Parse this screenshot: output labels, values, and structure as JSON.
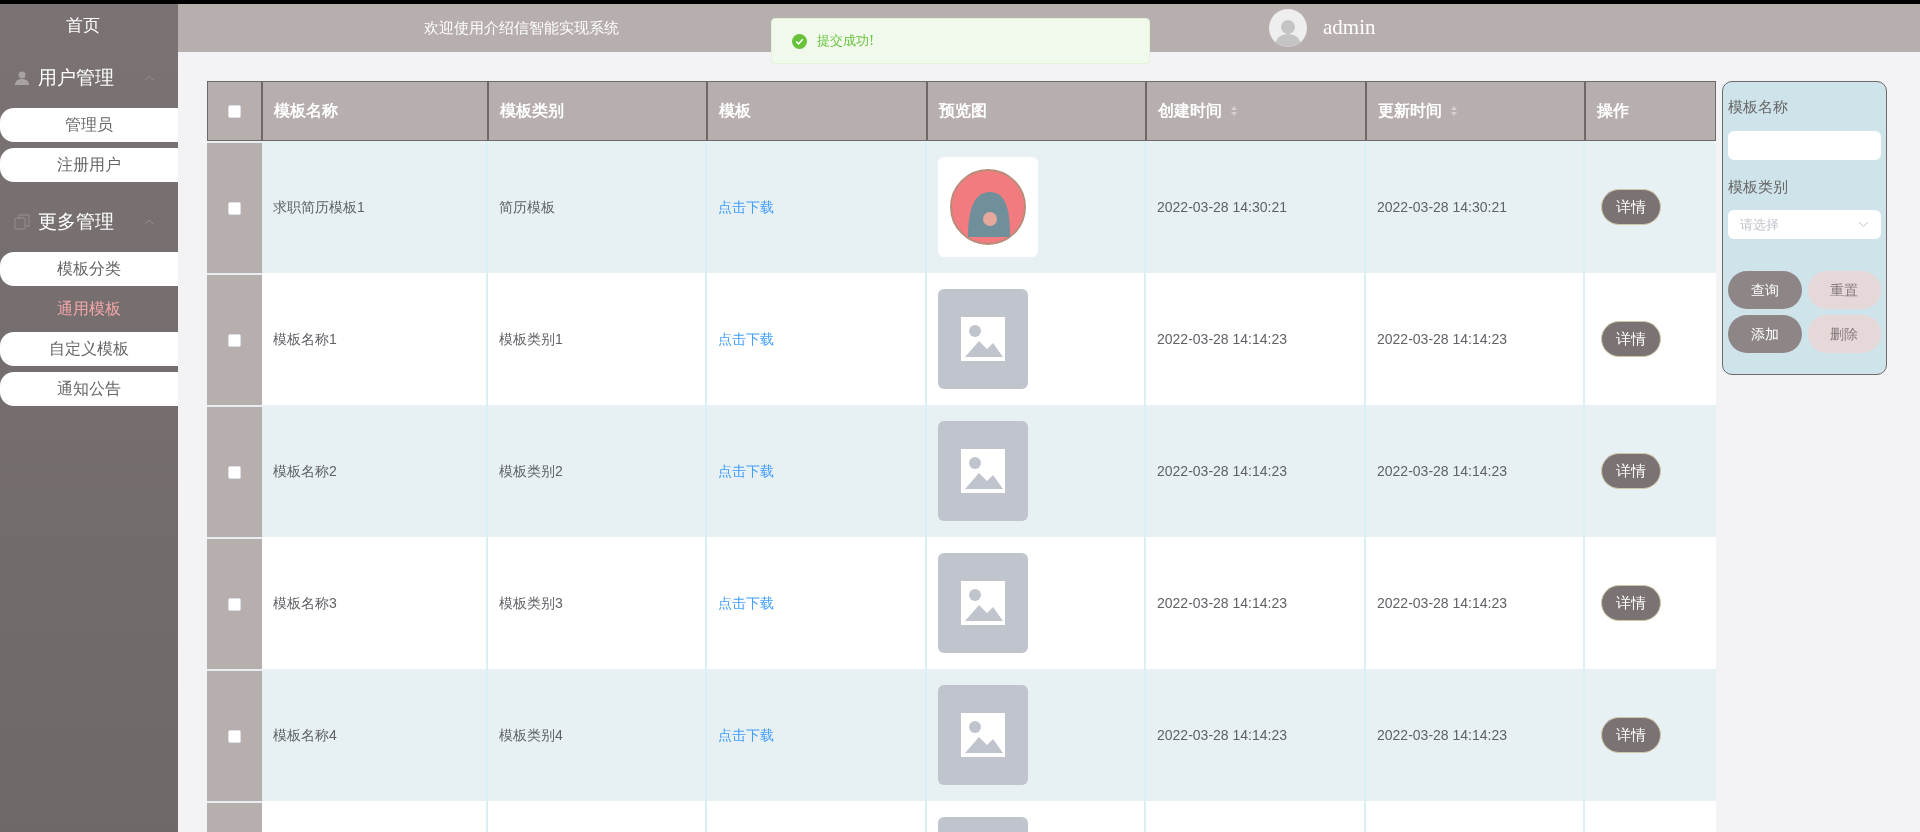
{
  "header": {
    "title": "欢迎使用介绍信智能实现系统",
    "user": "admin"
  },
  "toast": {
    "message": "提交成功!"
  },
  "sidebar": {
    "home": "首页",
    "groups": [
      {
        "title": "用户管理",
        "kind": "user",
        "expanded": true,
        "items": [
          {
            "label": "管理员",
            "selected": false
          },
          {
            "label": "注册用户",
            "selected": false
          }
        ]
      },
      {
        "title": "更多管理",
        "kind": "copy",
        "expanded": true,
        "items": [
          {
            "label": "模板分类",
            "selected": false
          },
          {
            "label": "通用模板",
            "selected": true
          },
          {
            "label": "自定义模板",
            "selected": false
          },
          {
            "label": "通知公告",
            "selected": false
          }
        ]
      }
    ]
  },
  "table": {
    "header_checked": false,
    "columns": [
      {
        "label": "模板名称",
        "sortable": false
      },
      {
        "label": "模板类别",
        "sortable": false
      },
      {
        "label": "模板",
        "sortable": false
      },
      {
        "label": "预览图",
        "sortable": false
      },
      {
        "label": "创建时间",
        "sortable": true
      },
      {
        "label": "更新时间",
        "sortable": true
      },
      {
        "label": "操作",
        "sortable": false
      }
    ],
    "rows": [
      {
        "checked": false,
        "name": "求职简历模板1",
        "category": "简历模板",
        "link": "点击下载",
        "kind": "photo",
        "created": "2022-03-28 14:30:21",
        "updated": "2022-03-28 14:30:21",
        "action": "详情"
      },
      {
        "checked": false,
        "name": "模板名称1",
        "category": "模板类别1",
        "link": "点击下载",
        "kind": "placeholder",
        "created": "2022-03-28 14:14:23",
        "updated": "2022-03-28 14:14:23",
        "action": "详情"
      },
      {
        "checked": false,
        "name": "模板名称2",
        "category": "模板类别2",
        "link": "点击下载",
        "kind": "placeholder",
        "created": "2022-03-28 14:14:23",
        "updated": "2022-03-28 14:14:23",
        "action": "详情"
      },
      {
        "checked": false,
        "name": "模板名称3",
        "category": "模板类别3",
        "link": "点击下载",
        "kind": "placeholder",
        "created": "2022-03-28 14:14:23",
        "updated": "2022-03-28 14:14:23",
        "action": "详情"
      },
      {
        "checked": false,
        "name": "模板名称4",
        "category": "模板类别4",
        "link": "点击下载",
        "kind": "placeholder",
        "created": "2022-03-28 14:14:23",
        "updated": "2022-03-28 14:14:23",
        "action": "详情"
      },
      {
        "kind": "placeholder"
      }
    ]
  },
  "search": {
    "name_label": "模板名称",
    "category_label": "模板类别",
    "category_placeholder": "请选择",
    "buttons": [
      {
        "label": "查询",
        "disabled": false
      },
      {
        "label": "重置",
        "disabled": true
      },
      {
        "label": "添加",
        "disabled": false
      },
      {
        "label": "删除",
        "disabled": true
      }
    ]
  }
}
